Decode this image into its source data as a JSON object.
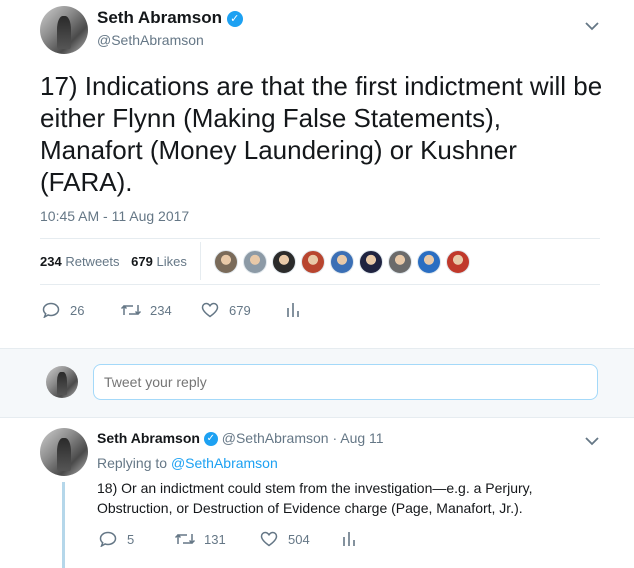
{
  "tweet": {
    "author_name": "Seth Abramson",
    "verified_mark": "✓",
    "author_handle": "@SethAbramson",
    "text": "17) Indications are that the first indictment will be either Flynn (Making False Statements), Manafort (Money Laundering) or Kushner (FARA).",
    "timestamp": "10:45 AM - 11 Aug 2017",
    "retweets_count": "234",
    "retweets_label": "Retweets",
    "likes_count": "679",
    "likes_label": "Likes",
    "likers": [
      {
        "icon": "liker-avatar-1",
        "color": "#7a6b5a"
      },
      {
        "icon": "liker-avatar-2",
        "color": "#8c9aa6"
      },
      {
        "icon": "liker-avatar-3",
        "color": "#2b2b2b"
      },
      {
        "icon": "liker-avatar-4",
        "color": "#b8452f"
      },
      {
        "icon": "liker-avatar-5",
        "color": "#3b6fb5"
      },
      {
        "icon": "liker-avatar-6",
        "color": "#1f2340"
      },
      {
        "icon": "liker-avatar-7",
        "color": "#6b6b6b"
      },
      {
        "icon": "liker-avatar-8",
        "color": "#2a6ec2"
      },
      {
        "icon": "liker-avatar-9",
        "color": "#c0392b"
      }
    ],
    "actions": {
      "reply_count": "26",
      "retweet_count": "234",
      "like_count": "679"
    }
  },
  "reply_box": {
    "placeholder": "Tweet your reply"
  },
  "reply_tweet": {
    "author_name": "Seth Abramson",
    "author_handle": "@SethAbramson",
    "date": "Aug 11",
    "separator": "·",
    "replying_label": "Replying to",
    "replying_handle": "@SethAbramson",
    "text": "18) Or an indictment could stem from the investigation—e.g. a Perjury, Obstruction, or Destruction of Evidence charge (Page, Manafort, Jr.).",
    "actions": {
      "reply_count": "5",
      "retweet_count": "131",
      "like_count": "504"
    }
  },
  "colors": {
    "accent": "#1da1f2",
    "muted": "#657786",
    "divider": "#e6ecf0",
    "reply_bg": "#f5f8fa",
    "thread_line": "#b5d7ea"
  }
}
